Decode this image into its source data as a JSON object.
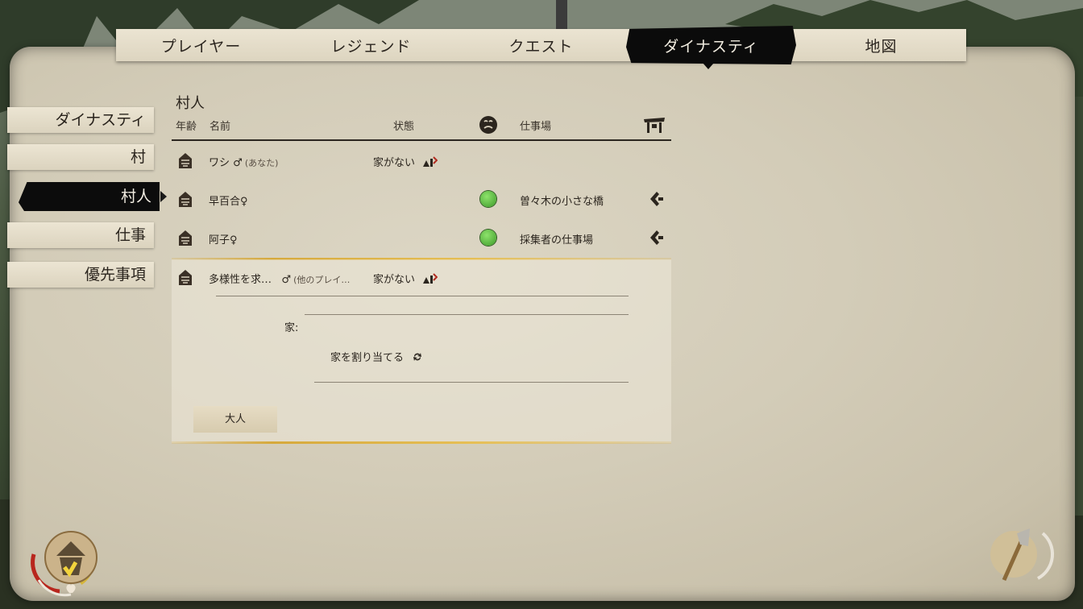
{
  "tabs": [
    {
      "label": "プレイヤー",
      "active": false
    },
    {
      "label": "レジェンド",
      "active": false
    },
    {
      "label": "クエスト",
      "active": false
    },
    {
      "label": "ダイナスティ",
      "active": true
    },
    {
      "label": "地図",
      "active": false
    }
  ],
  "side_menu": [
    {
      "label": "ダイナスティ",
      "active": false
    },
    {
      "label": "村",
      "active": false
    },
    {
      "label": "村人",
      "active": true
    },
    {
      "label": "仕事",
      "active": false
    },
    {
      "label": "優先事項",
      "active": false
    }
  ],
  "section": {
    "title": "村人",
    "headers": {
      "age": "年齢",
      "name": "名前",
      "status": "状態",
      "workplace": "仕事場"
    }
  },
  "villagers": [
    {
      "name": "ワシ",
      "gender": "♂",
      "tag": "(あなた)",
      "status": "家がない",
      "mood": "",
      "workplace": ""
    },
    {
      "name": "早百合",
      "gender": "♀",
      "tag": "",
      "status": "",
      "mood": "happy",
      "workplace": "曽々木の小さな橋"
    },
    {
      "name": "阿子",
      "gender": "♀",
      "tag": "",
      "status": "",
      "mood": "happy",
      "workplace": "採集者の仕事場"
    },
    {
      "name": "多様性を求…",
      "gender": "♂",
      "tag": "(他のプレイ…",
      "status": "家がない",
      "mood": "",
      "workplace": ""
    }
  ],
  "detail": {
    "home_label": "家:",
    "assign_label": "家を割り当てる",
    "age_button": "大人"
  },
  "colors": {
    "gold": "#d6a93c",
    "mood_green": "#5cc13c",
    "ink": "#0b0b0b"
  }
}
